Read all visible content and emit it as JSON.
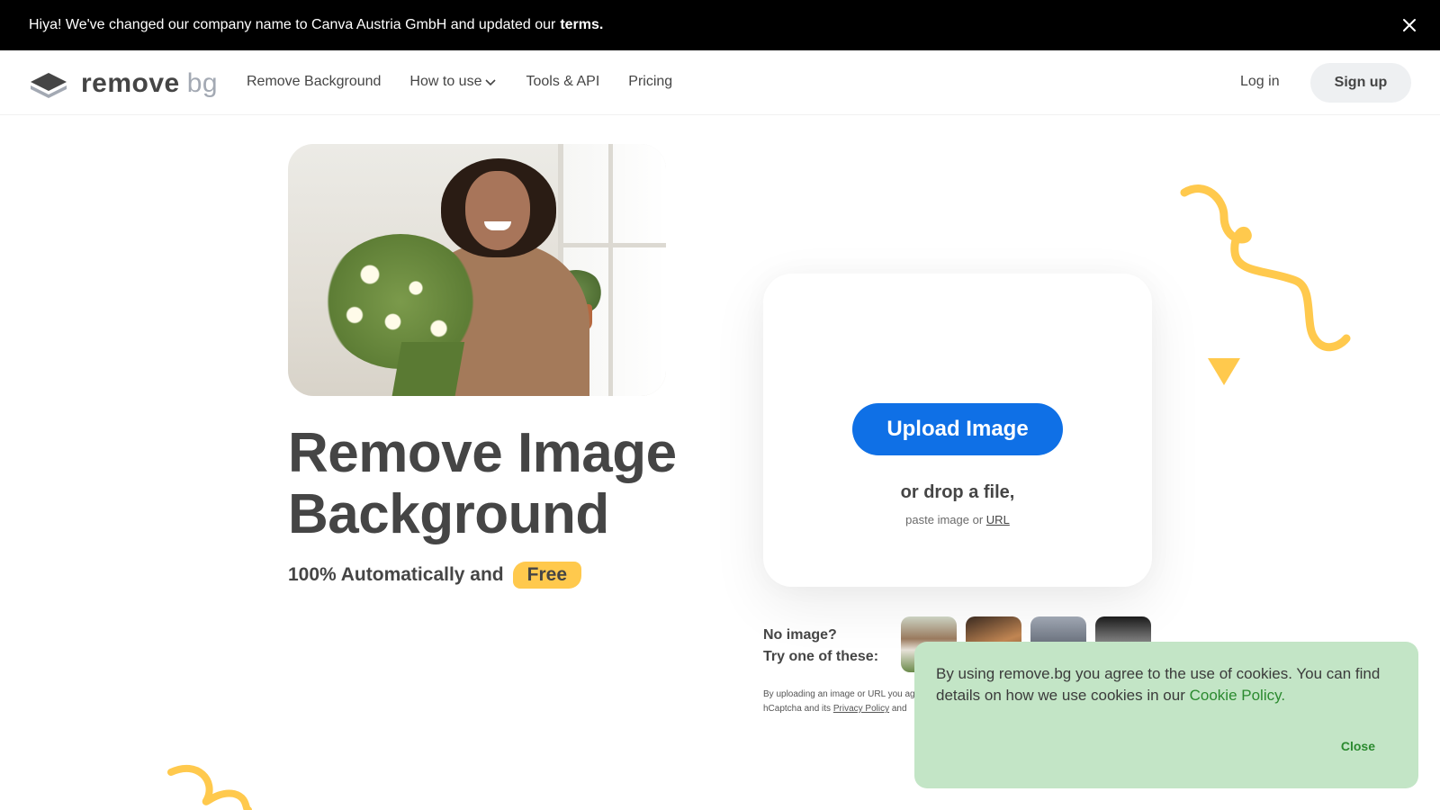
{
  "announcement": {
    "text": "Hiya! We've changed our company name to Canva Austria GmbH and updated our",
    "terms_link": "terms."
  },
  "nav": {
    "logo": {
      "word1": "remove",
      "word2": "bg"
    },
    "links": [
      {
        "label": "Remove Background"
      },
      {
        "label": "How to use"
      },
      {
        "label": "Tools & API"
      },
      {
        "label": "Pricing"
      }
    ],
    "login": "Log in",
    "signup": "Sign up"
  },
  "hero": {
    "title_line1": "Remove Image",
    "title_line2": "Background",
    "subtitle": "100% Automatically and",
    "free_badge": "Free"
  },
  "upload": {
    "button": "Upload Image",
    "drop_text": "or drop a file,",
    "paste_text": "paste image or",
    "url_link": "URL"
  },
  "samples": {
    "line1": "No image?",
    "line2": "Try one of these:"
  },
  "legal": {
    "text1": "By uploading an image or URL you ag",
    "text2": "hCaptcha and its",
    "privacy_link": "Privacy Policy",
    "text3": "and"
  },
  "cookie": {
    "message": "By using remove.bg you agree to the use of cookies. You can find details on how we use cookies in our",
    "policy_link": "Cookie Policy.",
    "close": "Close"
  },
  "colors": {
    "primary": "#0f70e6",
    "accent_yellow": "#ffc94d",
    "cookie_bg": "#c3e5c6",
    "cookie_link": "#2b8a2f",
    "text": "#454545"
  },
  "icons": {
    "announce_close": "close-icon",
    "how_to_use_chevron": "chevron-down-icon",
    "logo": "layers-logo-icon"
  }
}
